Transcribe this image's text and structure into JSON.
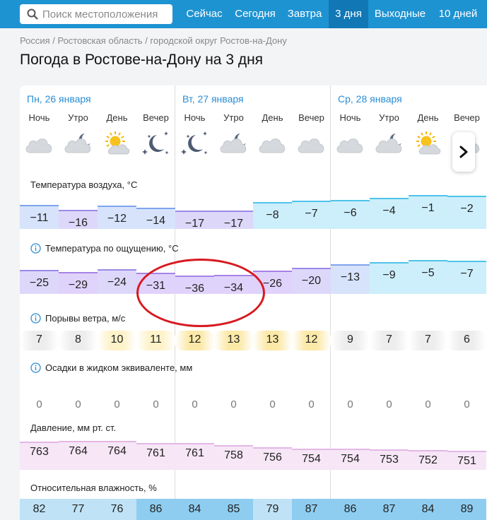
{
  "search": {
    "placeholder": "Поиск местоположения"
  },
  "nav": [
    "Сейчас",
    "Сегодня",
    "Завтра",
    "3 дня",
    "Выходные",
    "10 дней"
  ],
  "nav_active": 3,
  "breadcrumbs": "Россия / Ростовская область / городской округ Ростов-на-Дону",
  "page_title": "Погода в Ростове-на-Дону на 3 дня",
  "days": [
    {
      "label": "Пн, 26 января"
    },
    {
      "label": "Вт, 27 января"
    },
    {
      "label": "Ср, 28 января"
    }
  ],
  "periods": [
    "Ночь",
    "Утро",
    "День",
    "Вечер",
    "Ночь",
    "Утро",
    "День",
    "Вечер",
    "Ночь",
    "Утро",
    "День",
    "Вечер"
  ],
  "icons": [
    "cloud-icon",
    "cloud-moon-icon",
    "sun-cloud-icon",
    "moon-stars-icon",
    "moon-stars-icon",
    "cloud-moon-icon",
    "cloud-icon",
    "cloud-icon",
    "cloud-icon",
    "cloud-moon-icon",
    "sun-cloud-icon",
    "cloud-icon"
  ],
  "rows": {
    "temp_label": "Температура воздуха, °C",
    "temp": [
      "−11",
      "−16",
      "−12",
      "−14",
      "−17",
      "−17",
      "−8",
      "−7",
      "−6",
      "−4",
      "−1",
      "−2"
    ],
    "feels_label": "Температура по ощущению, °C",
    "feels": [
      "−25",
      "−29",
      "−24",
      "−31",
      "−36",
      "−34",
      "−26",
      "−20",
      "−13",
      "−9",
      "−5",
      "−7"
    ],
    "gust_label": "Порывы ветра, м/с",
    "gust": [
      "7",
      "8",
      "10",
      "11",
      "12",
      "13",
      "13",
      "12",
      "9",
      "7",
      "7",
      "6"
    ],
    "precip_label": "Осадки в жидком эквиваленте, мм",
    "precip": [
      "0",
      "0",
      "0",
      "0",
      "0",
      "0",
      "0",
      "0",
      "0",
      "0",
      "0",
      "0"
    ],
    "pressure_label": "Давление, мм рт. ст.",
    "pressure": [
      "763",
      "764",
      "764",
      "761",
      "761",
      "758",
      "756",
      "754",
      "754",
      "753",
      "752",
      "751"
    ],
    "humidity_label": "Относительная влажность, %",
    "humidity": [
      "82",
      "77",
      "76",
      "86",
      "84",
      "85",
      "79",
      "87",
      "86",
      "87",
      "84",
      "89"
    ]
  },
  "colors": {
    "topbar": "#1e93d2",
    "nav_active": "#1177b5",
    "link": "#2a8dd4",
    "highlight_circle": "#d71920"
  }
}
